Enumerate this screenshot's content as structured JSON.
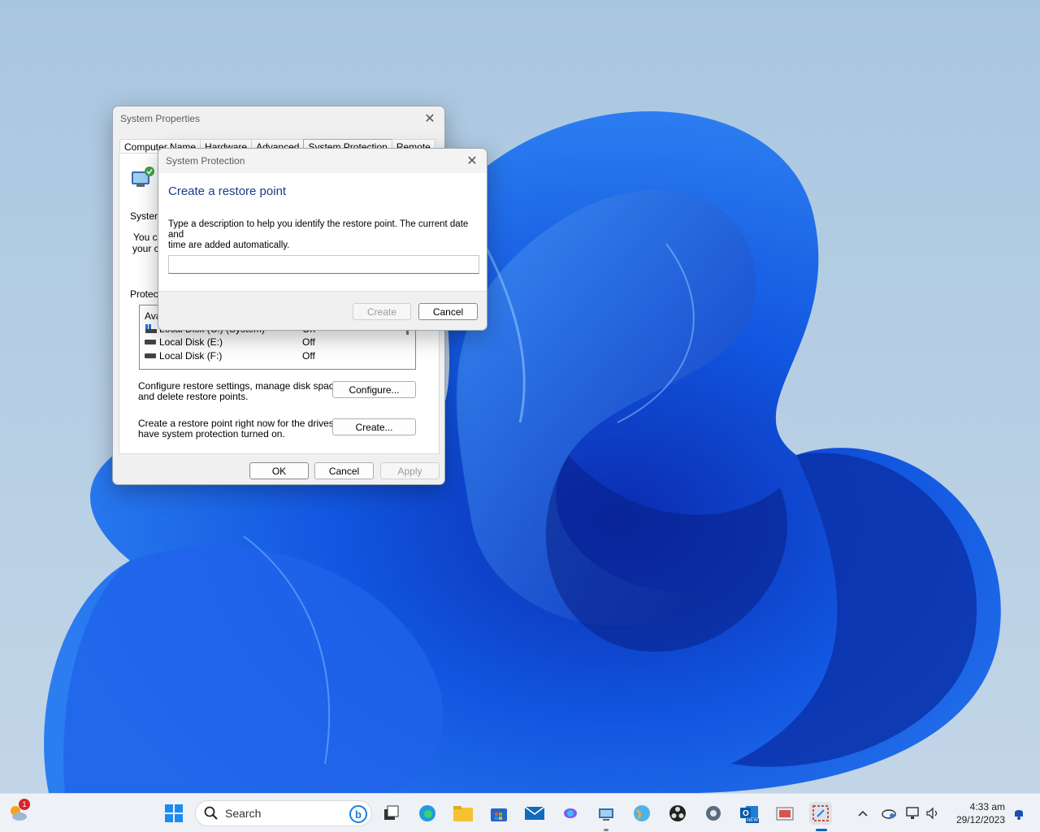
{
  "system_properties": {
    "title": "System Properties",
    "tabs": [
      "Computer Name",
      "Hardware",
      "Advanced",
      "System Protection",
      "Remote"
    ],
    "partial_labels": {
      "system": "System",
      "you_ca": "You ca",
      "your_co": "your co",
      "protecti": "Protecti",
      "ava": "Ava"
    },
    "drives": [
      {
        "name": "Local Disk (C:) (System)",
        "protection": "On"
      },
      {
        "name": "Local Disk (E:)",
        "protection": "Off"
      },
      {
        "name": "Local Disk (F:)",
        "protection": "Off"
      }
    ],
    "configure_text_1": "Configure restore settings, manage disk space,",
    "configure_text_2": "and delete restore points.",
    "configure_button": "Configure...",
    "create_text_1": "Create a restore point right now for the drives that",
    "create_text_2": "have system protection turned on.",
    "create_button": "Create...",
    "ok": "OK",
    "cancel": "Cancel",
    "apply": "Apply"
  },
  "system_protection": {
    "title": "System Protection",
    "heading": "Create a restore point",
    "description_1": "Type a description to help you identify the restore point. The current date and",
    "description_2": "time are added automatically.",
    "input_value": "",
    "create": "Create",
    "cancel": "Cancel"
  },
  "taskbar": {
    "search_placeholder": "Search",
    "weather_badge": "1",
    "time": "4:33 am",
    "date": "29/12/2023",
    "outlook_badge": "NEW"
  },
  "colors": {
    "heading_blue": "#1a3c8c",
    "accent": "#0067c0"
  }
}
